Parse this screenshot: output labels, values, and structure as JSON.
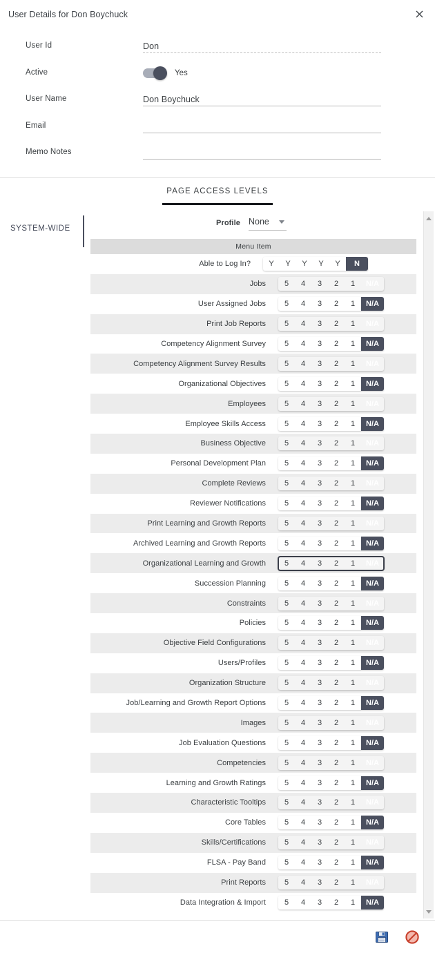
{
  "dialog": {
    "title": "User Details for Don Boychuck",
    "close_icon": "close-icon"
  },
  "form": {
    "fields": [
      {
        "label": "User Id",
        "value": "Don",
        "style": "dashed"
      },
      {
        "label": "Active",
        "value": "Yes",
        "style": "toggle",
        "toggle_on": true
      },
      {
        "label": "User Name",
        "value": "Don Boychuck",
        "style": "solid"
      },
      {
        "label": "Email",
        "value": "",
        "style": "solid"
      },
      {
        "label": "Memo Notes",
        "value": "",
        "style": "solid"
      }
    ]
  },
  "tabs": [
    {
      "label": "PAGE ACCESS LEVELS",
      "active": true
    }
  ],
  "scope": {
    "label": "SYSTEM-WIDE"
  },
  "profile": {
    "label": "Profile",
    "value": "None",
    "caret_icon": "chevron-down-icon"
  },
  "table": {
    "header": "Menu Item",
    "yes_no_options": [
      "Y",
      "Y",
      "Y",
      "Y",
      "Y",
      "N"
    ],
    "level_options": [
      "5",
      "4",
      "3",
      "2",
      "1",
      "N/A"
    ],
    "rows": [
      {
        "label": "Able to Log In?",
        "type": "yn",
        "selected": "N"
      },
      {
        "label": "Jobs",
        "type": "level",
        "selected": "N/A"
      },
      {
        "label": "User Assigned Jobs",
        "type": "level",
        "selected": "N/A"
      },
      {
        "label": "Print Job Reports",
        "type": "level",
        "selected": "N/A"
      },
      {
        "label": "Competency Alignment Survey",
        "type": "level",
        "selected": "N/A"
      },
      {
        "label": "Competency Alignment Survey Results",
        "type": "level",
        "selected": "N/A"
      },
      {
        "label": "Organizational Objectives",
        "type": "level",
        "selected": "N/A"
      },
      {
        "label": "Employees",
        "type": "level",
        "selected": "N/A"
      },
      {
        "label": "Employee Skills Access",
        "type": "level",
        "selected": "N/A"
      },
      {
        "label": "Business Objective",
        "type": "level",
        "selected": "N/A"
      },
      {
        "label": "Personal Development Plan",
        "type": "level",
        "selected": "N/A"
      },
      {
        "label": "Complete Reviews",
        "type": "level",
        "selected": "N/A"
      },
      {
        "label": "Reviewer Notifications",
        "type": "level",
        "selected": "N/A"
      },
      {
        "label": "Print Learning and Growth Reports",
        "type": "level",
        "selected": "N/A"
      },
      {
        "label": "Archived Learning and Growth Reports",
        "type": "level",
        "selected": "N/A"
      },
      {
        "label": "Organizational Learning and Growth",
        "type": "level",
        "selected": "N/A",
        "focused": true
      },
      {
        "label": "Succession Planning",
        "type": "level",
        "selected": "N/A"
      },
      {
        "label": "Constraints",
        "type": "level",
        "selected": "N/A"
      },
      {
        "label": "Policies",
        "type": "level",
        "selected": "N/A"
      },
      {
        "label": "Objective Field Configurations",
        "type": "level",
        "selected": "N/A"
      },
      {
        "label": "Users/Profiles",
        "type": "level",
        "selected": "N/A"
      },
      {
        "label": "Organization Structure",
        "type": "level",
        "selected": "N/A"
      },
      {
        "label": "Job/Learning and Growth Report Options",
        "type": "level",
        "selected": "N/A"
      },
      {
        "label": "Images",
        "type": "level",
        "selected": "N/A"
      },
      {
        "label": "Job Evaluation Questions",
        "type": "level",
        "selected": "N/A"
      },
      {
        "label": "Competencies",
        "type": "level",
        "selected": "N/A"
      },
      {
        "label": "Learning and Growth Ratings",
        "type": "level",
        "selected": "N/A"
      },
      {
        "label": "Characteristic Tooltips",
        "type": "level",
        "selected": "N/A"
      },
      {
        "label": "Core Tables",
        "type": "level",
        "selected": "N/A"
      },
      {
        "label": "Skills/Certifications",
        "type": "level",
        "selected": "N/A"
      },
      {
        "label": "FLSA - Pay Band",
        "type": "level",
        "selected": "N/A"
      },
      {
        "label": "Print Reports",
        "type": "level",
        "selected": "N/A"
      },
      {
        "label": "Data Integration & Import",
        "type": "level",
        "selected": "N/A"
      }
    ]
  },
  "footer": {
    "actions": [
      {
        "name": "save-icon",
        "title": "Save"
      },
      {
        "name": "cancel-icon",
        "title": "Cancel"
      }
    ]
  },
  "scrollbar": {
    "up_icon": "scroll-up-arrow-icon",
    "down_icon": "scroll-down-arrow-icon"
  },
  "colors": {
    "selected_button": "#4a4f5e",
    "row_alt": "#ececec",
    "header_bg": "#dcdcdc",
    "tab_underline": "#16181c",
    "save_icon": "#2b5797",
    "cancel_icon": "#d14836"
  }
}
